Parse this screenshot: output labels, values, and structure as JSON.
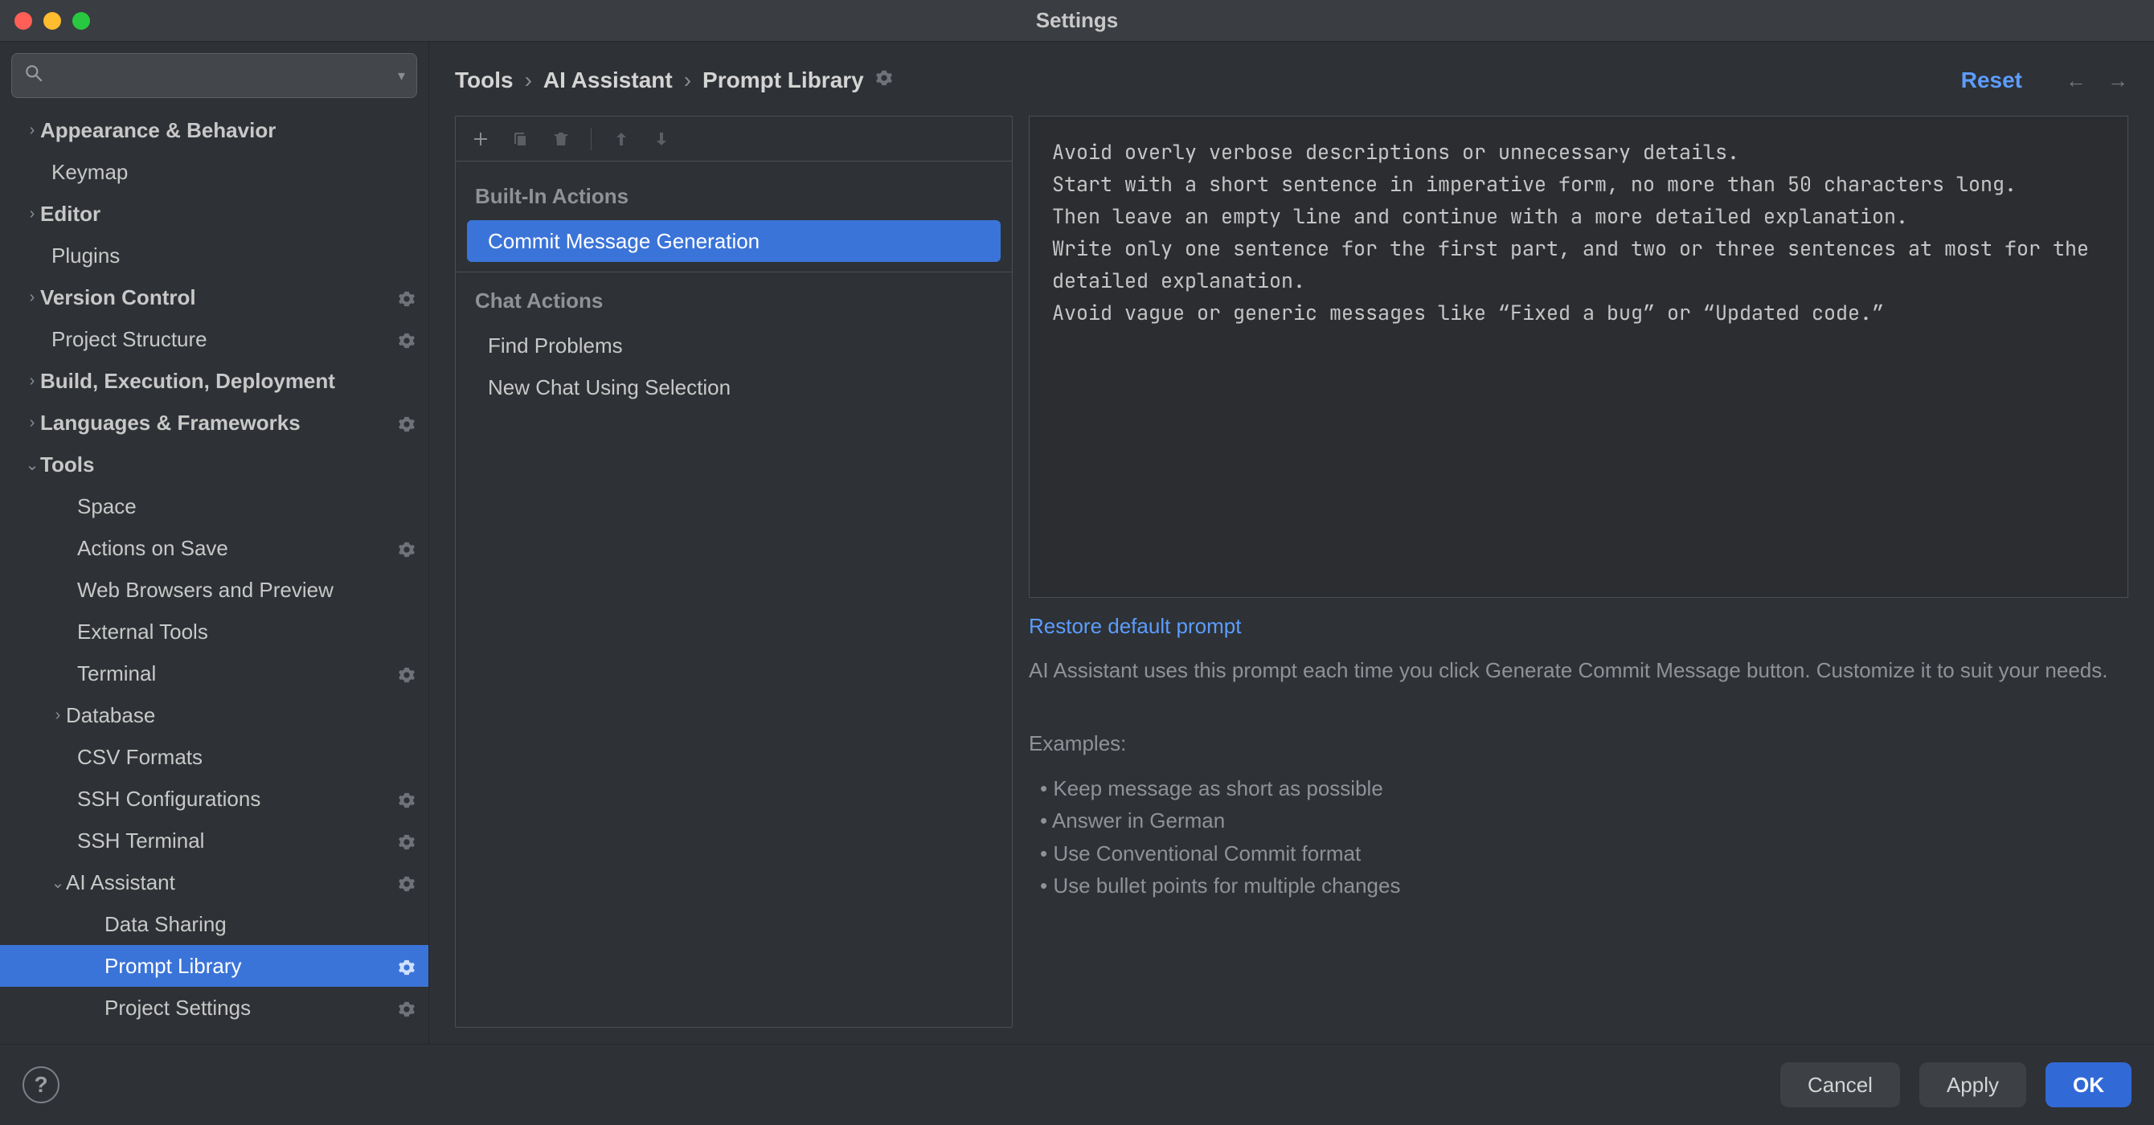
{
  "window": {
    "title": "Settings"
  },
  "search": {
    "placeholder": ""
  },
  "sidebar": {
    "items": [
      {
        "label": "Appearance & Behavior"
      },
      {
        "label": "Keymap"
      },
      {
        "label": "Editor"
      },
      {
        "label": "Plugins"
      },
      {
        "label": "Version Control"
      },
      {
        "label": "Project Structure"
      },
      {
        "label": "Build, Execution, Deployment"
      },
      {
        "label": "Languages & Frameworks"
      },
      {
        "label": "Tools"
      },
      {
        "label": "Space"
      },
      {
        "label": "Actions on Save"
      },
      {
        "label": "Web Browsers and Preview"
      },
      {
        "label": "External Tools"
      },
      {
        "label": "Terminal"
      },
      {
        "label": "Database"
      },
      {
        "label": "CSV Formats"
      },
      {
        "label": "SSH Configurations"
      },
      {
        "label": "SSH Terminal"
      },
      {
        "label": "AI Assistant"
      },
      {
        "label": "Data Sharing"
      },
      {
        "label": "Prompt Library"
      },
      {
        "label": "Project Settings"
      }
    ]
  },
  "breadcrumb": {
    "c0": "Tools",
    "c1": "AI Assistant",
    "c2": "Prompt Library",
    "sep": "›"
  },
  "header": {
    "reset": "Reset"
  },
  "prompts": {
    "group1": "Built-In Actions",
    "item1": "Commit Message Generation",
    "group2": "Chat Actions",
    "item2": "Find Problems",
    "item3": "New Chat Using Selection"
  },
  "editor": {
    "text": "Avoid overly verbose descriptions or unnecessary details.\nStart with a short sentence in imperative form, no more than 50 characters long.\nThen leave an empty line and continue with a more detailed explanation.\nWrite only one sentence for the first part, and two or three sentences at most for the detailed explanation.\nAvoid vague or generic messages like “Fixed a bug” or “Updated code.”"
  },
  "restore": "Restore default prompt",
  "desc": "AI Assistant uses this prompt each time you click Generate Commit Message button. Customize it to suit your needs.",
  "examples_label": "Examples:",
  "examples": {
    "e0": "Keep message as short as possible",
    "e1": "Answer in German",
    "e2": "Use Conventional Commit format",
    "e3": "Use bullet points for multiple changes"
  },
  "footer": {
    "help": "?",
    "cancel": "Cancel",
    "apply": "Apply",
    "ok": "OK"
  }
}
